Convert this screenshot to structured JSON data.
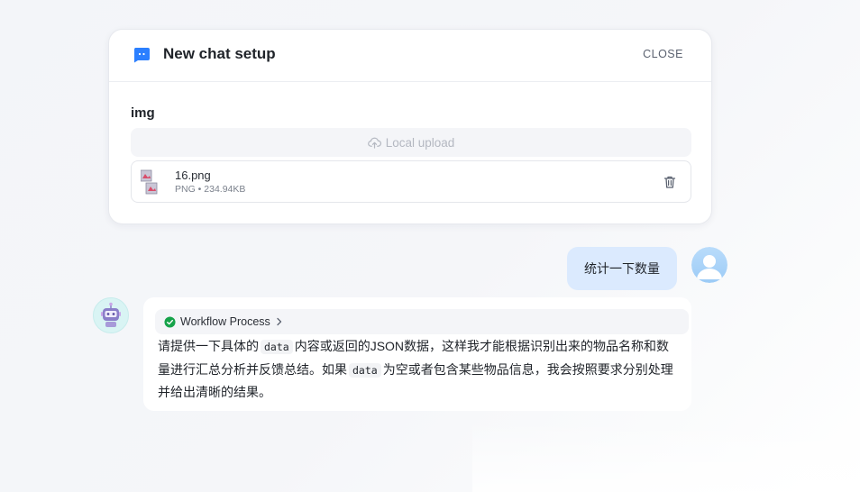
{
  "setup": {
    "title": "New chat setup",
    "close_label": "CLOSE",
    "field_label": "img",
    "upload_label": "Local upload",
    "file": {
      "name": "16.png",
      "meta": "PNG • 234.94KB"
    }
  },
  "conversation": {
    "user_message": "统计一下数量",
    "workflow_label": "Workflow Process",
    "bot_reply": {
      "part1": "请提供一下具体的",
      "code1": "data",
      "part2": "内容或返回的JSON数据，这样我才能根据识别出来的物品名称和数量进行汇总分析并反馈总结。如果",
      "code2": "data",
      "part3": "为空或者包含某些物品信息，我会按照要求分别处理并给出清晰的结果。"
    }
  },
  "colors": {
    "accent": "#2b7fff",
    "user_bubble": "#dbeafe",
    "success": "#16a34a"
  },
  "icons": [
    "chat-icon",
    "cloud-upload-icon",
    "image-icon",
    "trash-icon",
    "check-circle-icon",
    "chevron-right-icon",
    "user-avatar-icon",
    "bot-avatar-icon"
  ]
}
